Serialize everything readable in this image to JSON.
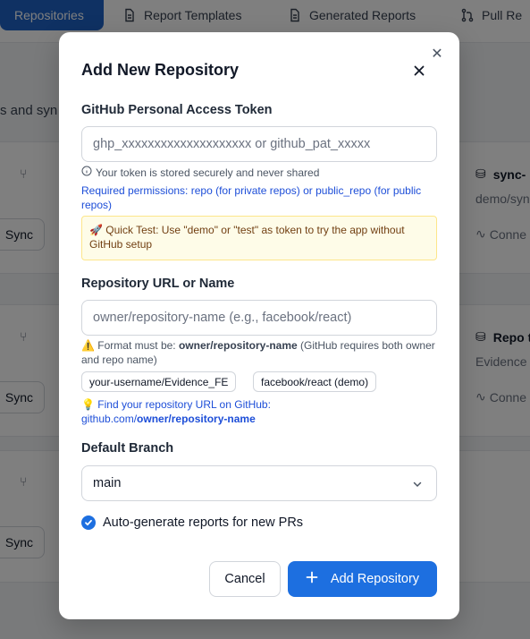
{
  "nav": {
    "items": [
      {
        "label": "Repositories",
        "icon": "repositories-icon"
      },
      {
        "label": "Report Templates",
        "icon": "document-icon"
      },
      {
        "label": "Generated Reports",
        "icon": "document-icon"
      },
      {
        "label": "Pull Re",
        "icon": "pull-request-icon"
      }
    ]
  },
  "background": {
    "partial_text": "s and syn",
    "sync_label": "Sync",
    "cards": [
      {
        "title": "sync-",
        "subtitle": "demo/syn",
        "status": "Conne"
      },
      {
        "title": "Repo t",
        "subtitle": "Evidence",
        "status": "Conne"
      }
    ]
  },
  "modal": {
    "title": "Add New Repository",
    "token": {
      "label": "GitHub Personal Access Token",
      "placeholder": "ghp_xxxxxxxxxxxxxxxxxxxx or github_pat_xxxxx",
      "hint": "Your token is stored securely and never shared",
      "permissions": "Required permissions: repo (for private repos) or public_repo (for public repos)",
      "quick_test": "🚀 Quick Test: Use \"demo\" or \"test\" as token to try the app without GitHub setup"
    },
    "repo": {
      "label": "Repository URL or Name",
      "placeholder": "owner/repository-name (e.g., facebook/react)",
      "warning_prefix": "⚠️ Format must be: ",
      "warning_bold": "owner/repository-name",
      "warning_suffix": " (GitHub requires both owner and repo name)",
      "chips": [
        "your-username/Evidence_FE",
        "facebook/react (demo)"
      ],
      "find_prefix": "💡 Find your repository URL on GitHub:",
      "find_url_prefix": "github.com/",
      "find_url_bold": "owner/repository-name"
    },
    "branch": {
      "label": "Default Branch",
      "value": "main"
    },
    "auto_generate": {
      "label": "Auto-generate reports for new PRs",
      "checked": true
    },
    "cancel_label": "Cancel",
    "add_label": "Add Repository"
  },
  "colors": {
    "primary": "#1d6fe0",
    "link": "#1d4ed8",
    "quick_bg": "#fefce8"
  }
}
